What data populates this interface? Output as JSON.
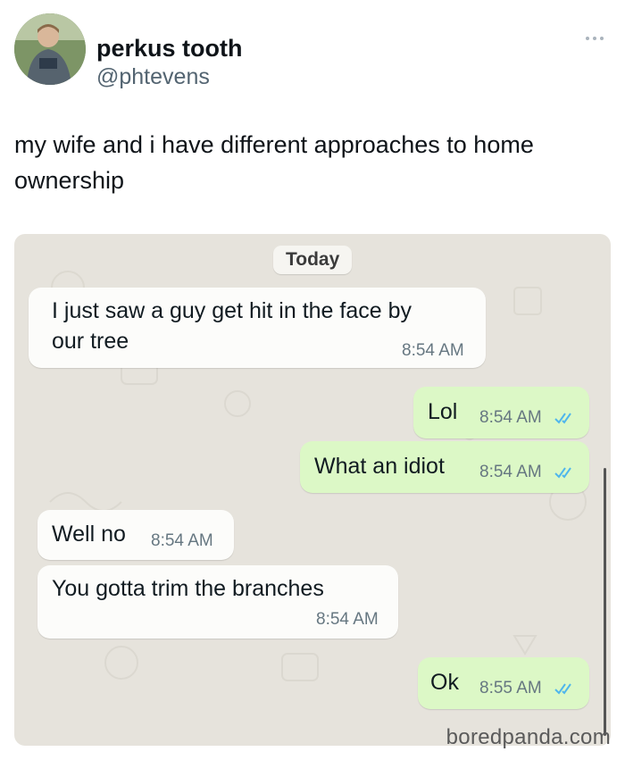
{
  "tweet": {
    "display_name": "perkus tooth",
    "handle": "@phtevens",
    "text": "my wife and i have different approaches to home ownership"
  },
  "chat": {
    "date_label": "Today",
    "messages": [
      {
        "direction": "incoming",
        "text_line1": "I just saw a guy get hit in the face by",
        "text_line2": "our tree",
        "time": "8:54 AM"
      },
      {
        "direction": "outgoing",
        "text": "Lol",
        "time": "8:54 AM",
        "read": true
      },
      {
        "direction": "outgoing",
        "text": "What an idiot",
        "time": "8:54 AM",
        "read": true
      },
      {
        "direction": "incoming",
        "text": "Well no",
        "time": "8:54 AM"
      },
      {
        "direction": "incoming",
        "text": "You gotta trim the branches",
        "time": "8:54 AM"
      },
      {
        "direction": "outgoing",
        "text": "Ok",
        "time": "8:55 AM",
        "read": true
      }
    ]
  },
  "watermark": "boredpanda.com",
  "colors": {
    "outgoing_bubble": "#dcf8c6",
    "incoming_bubble": "#fcfcfa",
    "chat_background": "#e6e3dc",
    "read_ticks": "#4fb6ec"
  }
}
